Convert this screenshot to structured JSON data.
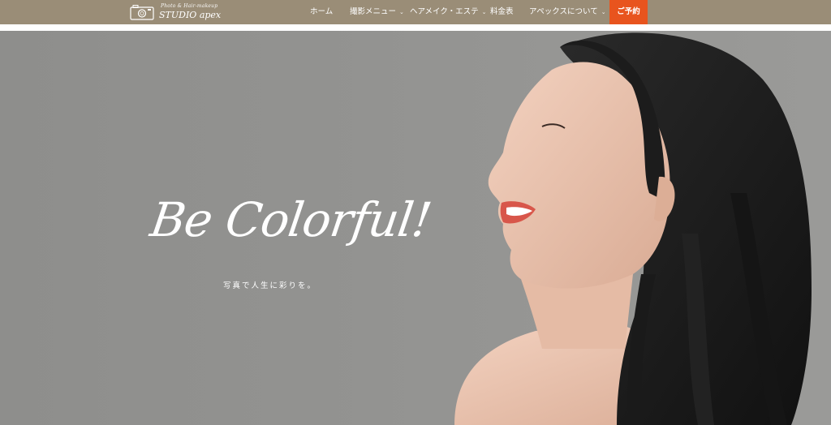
{
  "header": {
    "logo": {
      "tagline": "Photo & Hair-makeup",
      "brand": "STUDIO apex"
    },
    "nav": [
      {
        "label": "ホーム",
        "has_dropdown": false
      },
      {
        "label": "撮影メニュー",
        "has_dropdown": true
      },
      {
        "label": "ヘアメイク・エステ",
        "has_dropdown": true
      },
      {
        "label": "料金表",
        "has_dropdown": false
      },
      {
        "label": "アペックスについて",
        "has_dropdown": true
      }
    ],
    "reserve_label": "ご予約",
    "colors": {
      "header_bg": "#9a8d77",
      "reserve_bg": "#e8541e"
    }
  },
  "hero": {
    "headline": "Be Colorful!",
    "subline": "写真で人生に彩りを。",
    "background": "#939391",
    "image": "portrait of smiling woman with long dark hair, profile facing left"
  }
}
